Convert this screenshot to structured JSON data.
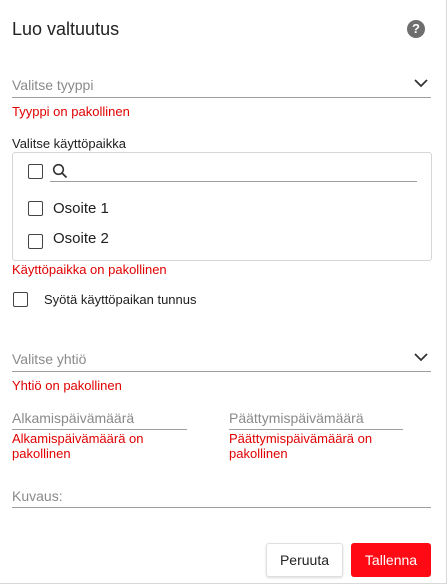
{
  "dialog": {
    "title": "Luo valtuutus",
    "help_icon": "question-circle-icon"
  },
  "type_select": {
    "placeholder": "Valitse tyyppi",
    "error": "Tyyppi on pakollinen"
  },
  "usage_place": {
    "label": "Valitse käyttöpaikka",
    "search_value": "",
    "options": [
      {
        "label": "Osoite 1",
        "checked": false
      },
      {
        "label": "Osoite 2",
        "checked": false
      }
    ],
    "error": "Käyttöpaikka on pakollinen"
  },
  "usage_place_id": {
    "label": "Syötä käyttöpaikan tunnus",
    "checked": false
  },
  "company_select": {
    "placeholder": "Valitse yhtiö",
    "error": "Yhtiö on pakollinen"
  },
  "start_date": {
    "placeholder": "Alkamispäivämäärä",
    "error": "Alkamispäivämäärä on pakollinen"
  },
  "end_date": {
    "placeholder": "Päättymispäivämäärä",
    "error": "Päättymispäivämäärä on pakollinen"
  },
  "description": {
    "placeholder": "Kuvaus:"
  },
  "actions": {
    "cancel_label": "Peruuta",
    "save_label": "Tallenna",
    "save_color": "#ff0a14"
  }
}
